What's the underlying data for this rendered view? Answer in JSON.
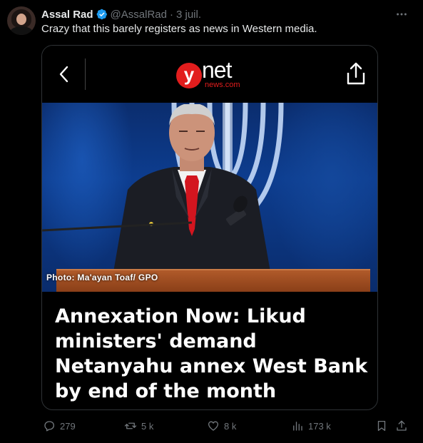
{
  "tweet": {
    "author_name": "Assal Rad",
    "handle": "@AssalRad",
    "separator": "·",
    "date": "3 juil.",
    "text": "Crazy that this barely registers as news in Western media."
  },
  "card": {
    "logo_letter": "y",
    "logo_word": "net",
    "logo_sub": "news.com",
    "photo_credit": "Photo: Ma'ayan Toaf/ GPO",
    "headline": "Annexation Now: Likud ministers' demand Netanyahu annex West Bank by end of the month"
  },
  "actions": {
    "replies": "279",
    "reposts": "5 k",
    "likes": "8 k",
    "views": "173 k"
  },
  "icons": {
    "verified": "verified-badge-icon",
    "more": "more-icon",
    "back": "chevron-left-icon",
    "share": "share-icon",
    "reply": "reply-icon",
    "repost": "repost-icon",
    "like": "heart-icon",
    "views": "views-icon",
    "bookmark": "bookmark-icon",
    "upload": "upload-icon"
  },
  "colors": {
    "verified_blue": "#1d9bf0",
    "muted": "#71767b",
    "ynet_red": "#e21d1d"
  }
}
